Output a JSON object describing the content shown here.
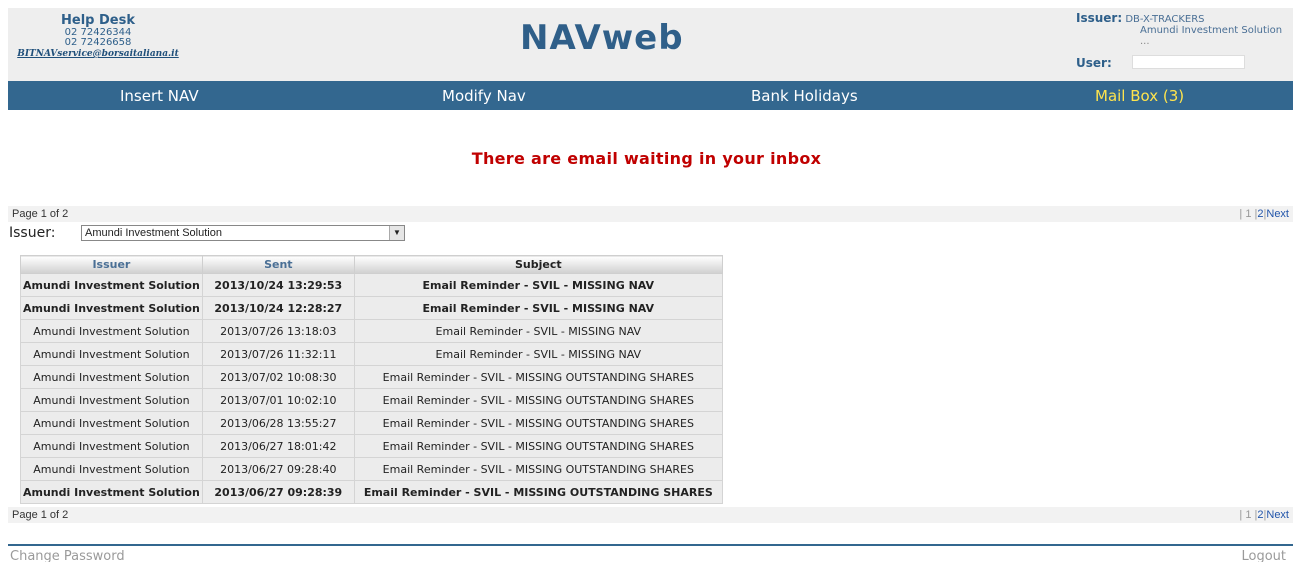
{
  "helpdesk": {
    "title": "Help Desk",
    "phone1": "02 72426344",
    "phone2": "02 72426658",
    "email": "BITNAVservice@borsaitaliana.it"
  },
  "logo": "NAVweb",
  "issuer_box": {
    "label": "Issuer:",
    "code": "DB-X-TRACKERS",
    "name": "Amundi Investment Solution",
    "more": "...",
    "user_label": "User:",
    "user_value": ""
  },
  "nav": {
    "insert": "Insert NAV",
    "modify": "Modify Nav",
    "holidays": "Bank Holidays",
    "mailbox": "Mail Box (3)"
  },
  "notice": "There are email waiting in your inbox",
  "pager": {
    "info": "Page 1 of 2",
    "sep1": "|",
    "p1": "1",
    "sep2": "|",
    "p2": "2",
    "sep3": "|",
    "next": "Next"
  },
  "filter": {
    "label": "Issuer:",
    "selected": "Amundi Investment Solution"
  },
  "table": {
    "headers": {
      "issuer": "Issuer",
      "sent": "Sent",
      "subject": "Subject"
    },
    "rows": [
      {
        "issuer": "Amundi Investment Solution",
        "sent": "2013/10/24 13:29:53",
        "subject": "Email Reminder - SVIL - MISSING NAV",
        "unread": true
      },
      {
        "issuer": "Amundi Investment Solution",
        "sent": "2013/10/24 12:28:27",
        "subject": "Email Reminder - SVIL - MISSING NAV",
        "unread": true
      },
      {
        "issuer": "Amundi Investment Solution",
        "sent": "2013/07/26 13:18:03",
        "subject": "Email Reminder - SVIL - MISSING NAV",
        "unread": false
      },
      {
        "issuer": "Amundi Investment Solution",
        "sent": "2013/07/26 11:32:11",
        "subject": "Email Reminder - SVIL - MISSING NAV",
        "unread": false
      },
      {
        "issuer": "Amundi Investment Solution",
        "sent": "2013/07/02 10:08:30",
        "subject": "Email Reminder - SVIL - MISSING OUTSTANDING SHARES",
        "unread": false
      },
      {
        "issuer": "Amundi Investment Solution",
        "sent": "2013/07/01 10:02:10",
        "subject": "Email Reminder - SVIL - MISSING OUTSTANDING SHARES",
        "unread": false
      },
      {
        "issuer": "Amundi Investment Solution",
        "sent": "2013/06/28 13:55:27",
        "subject": "Email Reminder - SVIL - MISSING OUTSTANDING SHARES",
        "unread": false
      },
      {
        "issuer": "Amundi Investment Solution",
        "sent": "2013/06/27 18:01:42",
        "subject": "Email Reminder - SVIL - MISSING OUTSTANDING SHARES",
        "unread": false
      },
      {
        "issuer": "Amundi Investment Solution",
        "sent": "2013/06/27 09:28:40",
        "subject": "Email Reminder - SVIL - MISSING OUTSTANDING SHARES",
        "unread": false
      },
      {
        "issuer": "Amundi Investment Solution",
        "sent": "2013/06/27 09:28:39",
        "subject": "Email Reminder - SVIL - MISSING OUTSTANDING SHARES",
        "unread": true
      }
    ]
  },
  "footer": {
    "change_password": "Change Password",
    "logout": "Logout"
  }
}
